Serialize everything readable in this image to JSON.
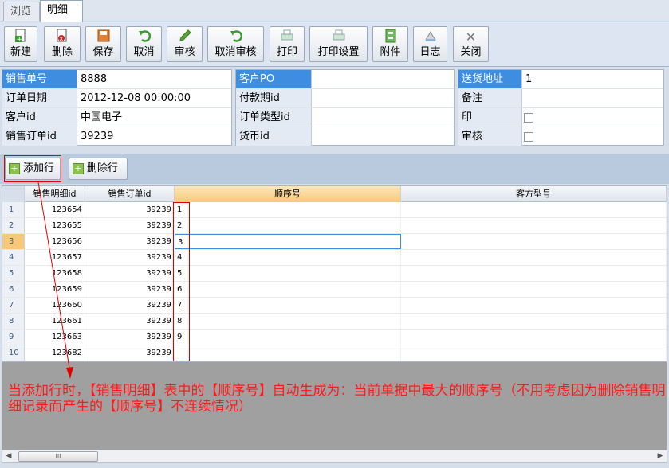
{
  "tabs": [
    {
      "label": "浏览"
    },
    {
      "label": "明细"
    }
  ],
  "toolbar": {
    "buttons": [
      {
        "label": "新建",
        "icon": "new-doc-icon"
      },
      {
        "label": "删除",
        "icon": "delete-doc-icon"
      },
      {
        "label": "保存",
        "icon": "save-icon"
      },
      {
        "label": "取消",
        "icon": "undo-icon"
      },
      {
        "label": "审核",
        "icon": "pencil-icon"
      },
      {
        "label": "取消审核",
        "icon": "undo-icon"
      },
      {
        "label": "打印",
        "icon": "printer-icon"
      },
      {
        "label": "打印设置",
        "icon": "printer-icon"
      },
      {
        "label": "附件",
        "icon": "attachment-icon"
      },
      {
        "label": "日志",
        "icon": "log-icon"
      },
      {
        "label": "关闭",
        "icon": "close-icon"
      }
    ]
  },
  "form": {
    "panel1": [
      {
        "label": "销售单号",
        "value": "8888"
      },
      {
        "label": "订单日期",
        "value": "2012-12-08 00:00:00"
      },
      {
        "label": "客户id",
        "value": "中国电子"
      },
      {
        "label": "销售订单id",
        "value": "39239"
      }
    ],
    "panel2": [
      {
        "label": "客户PO",
        "value": ""
      },
      {
        "label": "付款期id",
        "value": ""
      },
      {
        "label": "订单类型id",
        "value": ""
      },
      {
        "label": "货币id",
        "value": ""
      }
    ],
    "panel3": [
      {
        "label": "送货地址",
        "value": "1"
      },
      {
        "label": "备注",
        "value": ""
      },
      {
        "label": "印",
        "checked": false
      },
      {
        "label": "审核",
        "checked": false
      }
    ]
  },
  "rowbar": {
    "add_label": "添加行",
    "delete_label": "删除行"
  },
  "grid": {
    "columns": [
      "销售明细id",
      "销售订单id",
      "顺序号",
      "客方型号"
    ],
    "rows": [
      {
        "num": "1",
        "detail_id": "123654",
        "order_id": "39239",
        "seq": "1",
        "model": ""
      },
      {
        "num": "2",
        "detail_id": "123655",
        "order_id": "39239",
        "seq": "2",
        "model": ""
      },
      {
        "num": "3",
        "detail_id": "123656",
        "order_id": "39239",
        "seq": "3",
        "model": ""
      },
      {
        "num": "4",
        "detail_id": "123657",
        "order_id": "39239",
        "seq": "4",
        "model": ""
      },
      {
        "num": "5",
        "detail_id": "123658",
        "order_id": "39239",
        "seq": "5",
        "model": ""
      },
      {
        "num": "6",
        "detail_id": "123659",
        "order_id": "39239",
        "seq": "6",
        "model": ""
      },
      {
        "num": "7",
        "detail_id": "123660",
        "order_id": "39239",
        "seq": "7",
        "model": ""
      },
      {
        "num": "8",
        "detail_id": "123661",
        "order_id": "39239",
        "seq": "8",
        "model": ""
      },
      {
        "num": "9",
        "detail_id": "123663",
        "order_id": "39239",
        "seq": "9",
        "model": ""
      },
      {
        "num": "10",
        "detail_id": "123682",
        "order_id": "39239",
        "seq": "",
        "model": ""
      }
    ]
  },
  "annotation": {
    "text": "当添加行时，【销售明细】表中的【顺序号】自动生成为：当前单据中最大的顺序号（不用考虑因为删除销售明细记录而产生的【顺序号】不连续情况）"
  },
  "scrollbar": {
    "thumb_label": "III"
  },
  "colors": {
    "accent": "#3d8ee0",
    "annotation_red": "#ff1a1a",
    "selected_header": "#f6c979"
  }
}
